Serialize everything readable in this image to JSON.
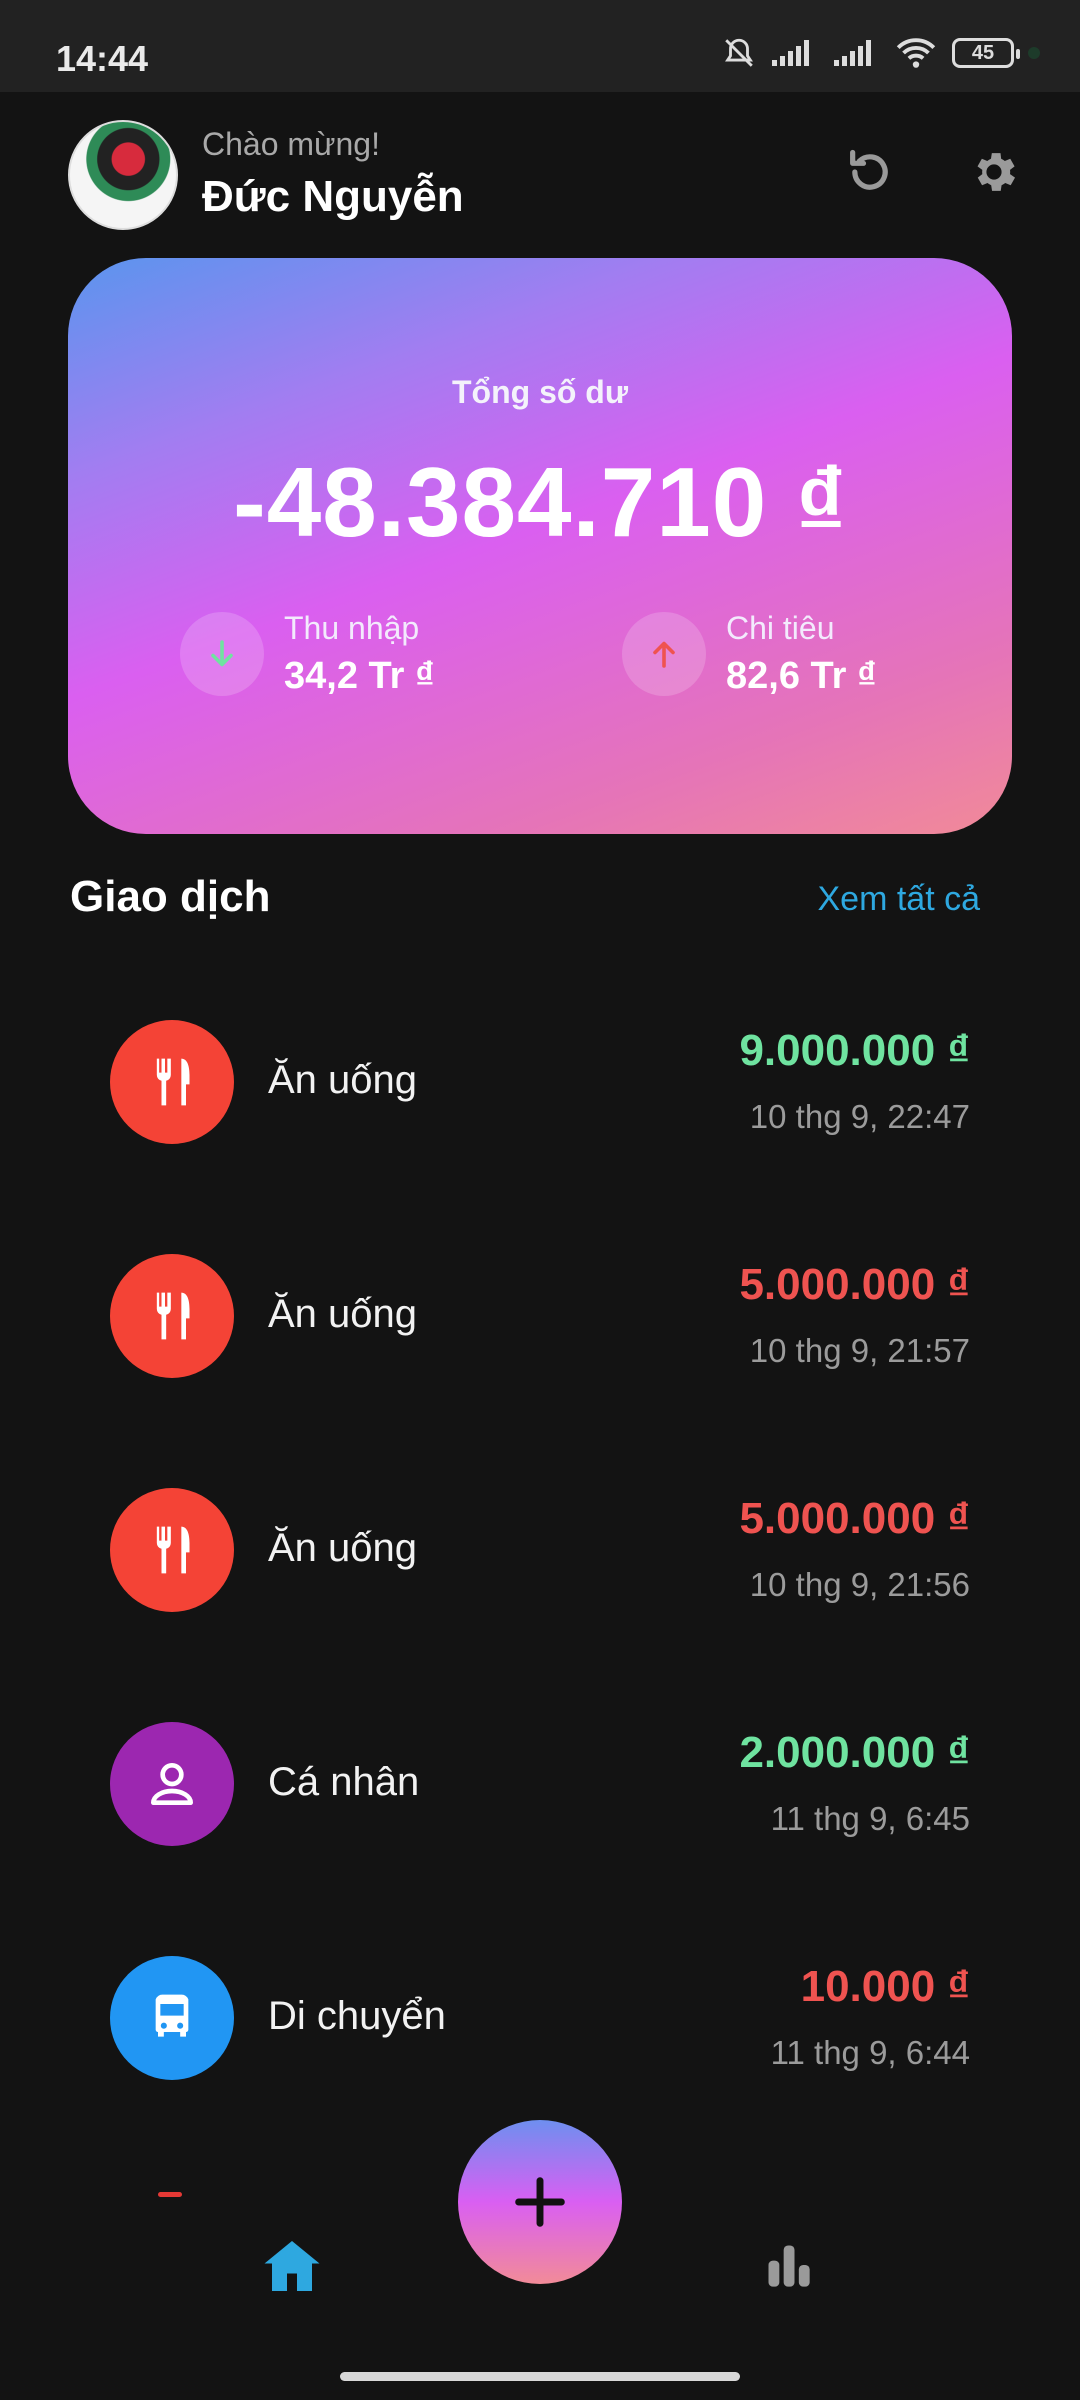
{
  "status_bar": {
    "time": "14:44",
    "battery": "45"
  },
  "header": {
    "greeting": "Chào mừng!",
    "user_name": "Đức Nguyễn"
  },
  "balance": {
    "label": "Tổng số dư",
    "value": "-48.384.710 ₫",
    "income": {
      "label": "Thu nhập",
      "value": "34,2 Tr ₫"
    },
    "expense": {
      "label": "Chi tiêu",
      "value": "82,6 Tr ₫"
    }
  },
  "transactions": {
    "title": "Giao dịch",
    "see_all": "Xem tất cả",
    "items": [
      {
        "category": "Ăn uống",
        "amount": "9.000.000 ₫",
        "time": "10 thg 9, 22:47",
        "type": "income",
        "icon": "fork-knife-icon"
      },
      {
        "category": "Ăn uống",
        "amount": "5.000.000 ₫",
        "time": "10 thg 9, 21:57",
        "type": "expense",
        "icon": "fork-knife-icon"
      },
      {
        "category": "Ăn uống",
        "amount": "5.000.000 ₫",
        "time": "10 thg 9, 21:56",
        "type": "expense",
        "icon": "fork-knife-icon"
      },
      {
        "category": "Cá nhân",
        "amount": "2.000.000 ₫",
        "time": "11 thg 9, 6:45",
        "type": "income",
        "icon": "person-icon"
      },
      {
        "category": "Di chuyển",
        "amount": "10.000 ₫",
        "time": "11 thg 9, 6:44",
        "type": "expense",
        "icon": "bus-icon"
      }
    ]
  },
  "colors": {
    "income": "#6fe3a0",
    "expense": "#ef5350",
    "food_icon_bg": "#f44336",
    "personal_icon_bg": "#9c27b0",
    "transport_icon_bg": "#2196f3",
    "accent": "#2ea8e0"
  }
}
